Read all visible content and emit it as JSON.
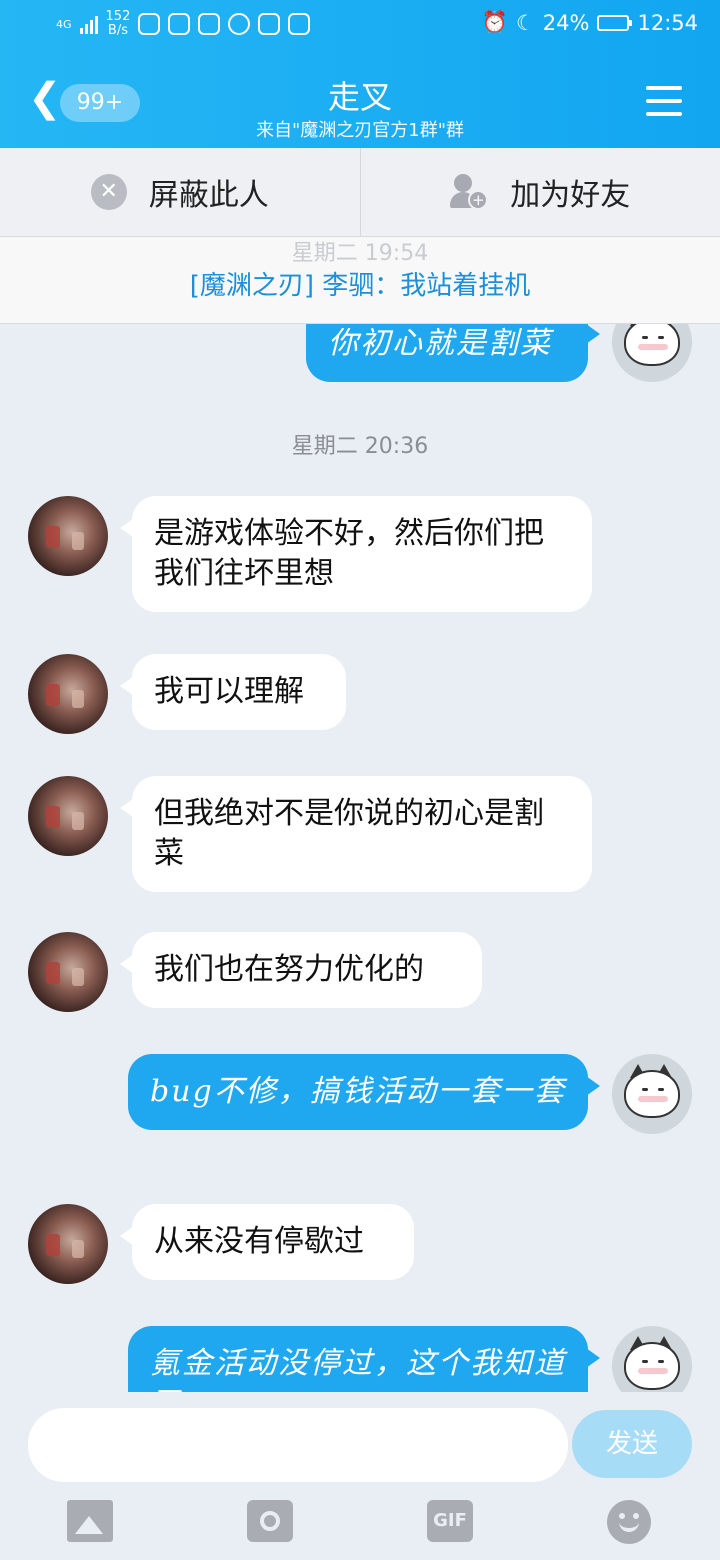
{
  "status_bar": {
    "network_label": "4G",
    "speed_value": "152",
    "speed_unit": "B/s",
    "battery_percent": "24%",
    "time": "12:54"
  },
  "header": {
    "back_badge": "99+",
    "title": "走叉",
    "subtitle": "来自\"魔渊之刃官方1群\"群"
  },
  "actions": {
    "block_label": "屏蔽此人",
    "add_friend_label": "加为好友"
  },
  "notice": {
    "ghost_time": "星期二 19:54",
    "text": "[魔渊之刃] 李驷：我站着挂机"
  },
  "messages": [
    {
      "side": "out",
      "text": "你初心就是割菜"
    },
    {
      "type": "time",
      "text": "星期二 20:36"
    },
    {
      "side": "in",
      "text": "是游戏体验不好，然后你们把我们往坏里想"
    },
    {
      "side": "in",
      "text": "我可以理解"
    },
    {
      "side": "in",
      "text": "但我绝对不是你说的初心是割菜"
    },
    {
      "side": "in",
      "text": "我们也在努力优化的"
    },
    {
      "side": "out",
      "text": "bug不修，搞钱活动一套一套"
    },
    {
      "side": "in",
      "text": "从来没有停歇过"
    },
    {
      "side": "out",
      "text": "氪金活动没停过，这个我知道了"
    }
  ],
  "input": {
    "send_label": "发送",
    "gif_label": "GIF"
  },
  "icons": {
    "block": "block-icon",
    "add_friend": "add-friend-icon",
    "image": "image-icon",
    "camera": "camera-icon",
    "gif": "gif-icon",
    "emoji": "emoji-icon"
  }
}
